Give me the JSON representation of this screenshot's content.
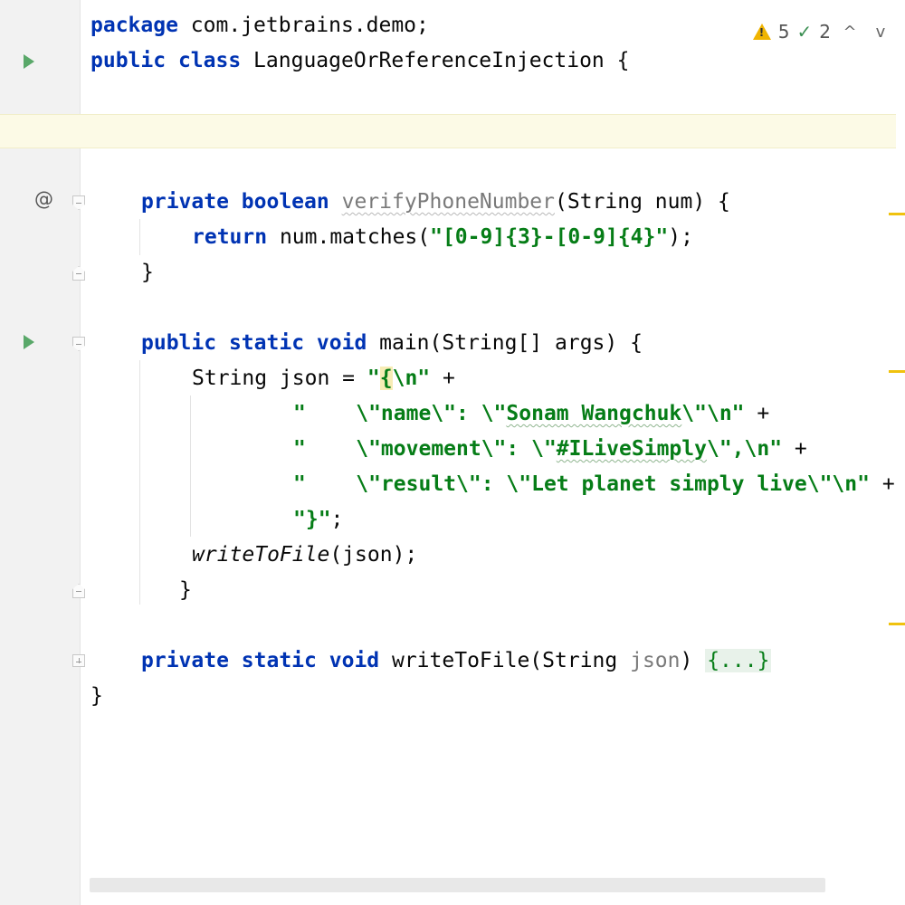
{
  "inspection": {
    "warnings": "5",
    "typos": "2",
    "prev_label": "^",
    "next_label": "v"
  },
  "code": {
    "l1": {
      "kw": "package",
      "rest": " com.jetbrains.demo;"
    },
    "l2": {
      "kw1": "public",
      "kw2": "class",
      "rest": " LanguageOrReferenceInjection {"
    },
    "l3": {
      "kw1": "private",
      "kw2": "boolean",
      "name": "verifyPhoneNumber",
      "rest": "(String num) {"
    },
    "l4": {
      "kw": "return",
      "mid": " num.matches(",
      "str": "\"[0-9]{3}-[0-9]{4}\"",
      "end": ");"
    },
    "l5": {
      "text": "}"
    },
    "l6": {
      "kw1": "public",
      "kw2": "static",
      "kw3": "void",
      "rest": " main(String[] args) {"
    },
    "l7": {
      "pre": "String json = ",
      "q": "\"",
      "brace": "{",
      "esc": "\\n",
      "q2": "\"",
      "plus": " +"
    },
    "l8": {
      "a": "\"    \\\"name\\\": \\\"",
      "typo": "Sonam Wangchuk",
      "b": "\\\"\\n\"",
      "plus": " +"
    },
    "l9": {
      "a": "\"    \\\"movement\\\": \\\"",
      "typo": "#ILiveSimply",
      "b": "\\\",\\n\"",
      "plus": " +"
    },
    "l10": {
      "a": "\"    \\\"result\\\": \\\"Let planet simply live\\\"\\n\"",
      "plus": " +"
    },
    "l11": {
      "str": "\"}\"",
      "end": ";"
    },
    "l12": {
      "call": "writeToFile",
      "rest": "(json);"
    },
    "l13": {
      "text": "}"
    },
    "l14": {
      "kw1": "private",
      "kw2": "static",
      "kw3": "void",
      "mid": " writeToFile(String ",
      "param": "json",
      "close": ") ",
      "folded": "{...}"
    },
    "l15": {
      "text": "}"
    }
  },
  "colors": {
    "keyword": "#0033b3",
    "string": "#067d17",
    "run_icon": "#59a869",
    "warning": "#f0b400",
    "caret_row": "#fcfae6"
  }
}
